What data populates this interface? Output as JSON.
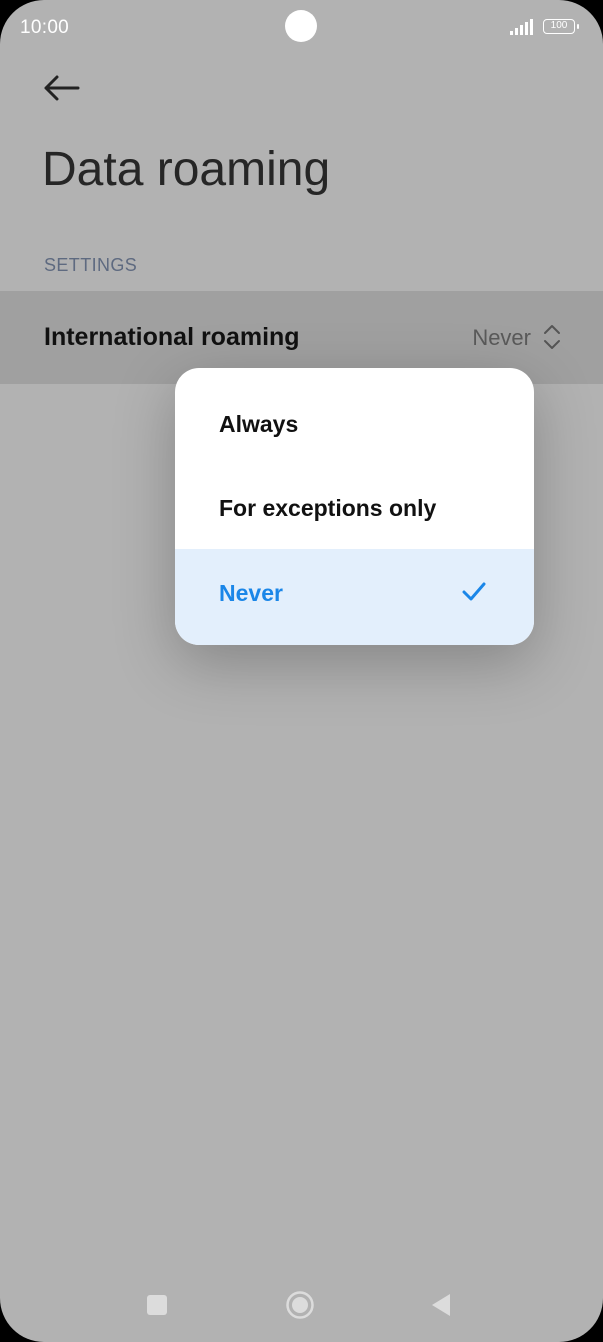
{
  "status_bar": {
    "time": "10:00",
    "battery": "100",
    "icons": [
      "signal-icon",
      "battery-icon"
    ]
  },
  "header": {
    "back_icon": "back-arrow-icon",
    "title": "Data roaming"
  },
  "section": {
    "label": "SETTINGS"
  },
  "setting": {
    "label": "International roaming",
    "value": "Never",
    "icon": "up-down-chevron-icon"
  },
  "dropdown": {
    "options": [
      {
        "label": "Always",
        "selected": false
      },
      {
        "label": "For exceptions only",
        "selected": false
      },
      {
        "label": "Never",
        "selected": true
      }
    ],
    "selected_icon": "checkmark-icon"
  },
  "nav": {
    "icons": [
      "recents-square-icon",
      "home-circle-icon",
      "back-triangle-icon"
    ]
  },
  "colors": {
    "scrim": "#b2b2b2",
    "accent": "#1a86e8",
    "selected_bg": "#e3effc"
  }
}
